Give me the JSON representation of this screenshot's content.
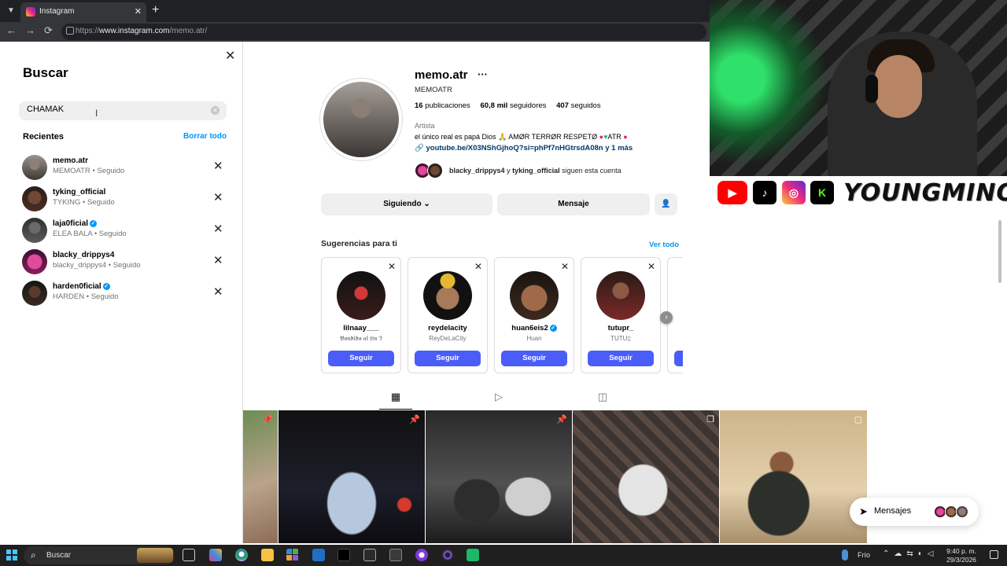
{
  "browser": {
    "tab_title": "Instagram",
    "tab_close": "✕",
    "new_tab": "+",
    "url_prefix": "https://",
    "url_host": "www.instagram.com",
    "url_path": "/memo.atr/"
  },
  "overlay": {
    "social_icons": [
      "youtube-icon",
      "tiktok-icon",
      "instagram-icon",
      "kick-icon"
    ],
    "channel_name": "YOUNGMINOR"
  },
  "search_panel": {
    "title": "Buscar",
    "query": "CHAMAK",
    "clear_glyph": "✕",
    "recents_title": "Recientes",
    "clear_all": "Borrar todo",
    "items": [
      {
        "name": "memo.atr",
        "sub": "MEMOATR • Seguido",
        "verified": false
      },
      {
        "name": "tyking_official",
        "sub": "TYKING • Seguido",
        "verified": false
      },
      {
        "name": "laja0ficial",
        "sub": "ELEA BALA • Seguido",
        "verified": true
      },
      {
        "name": "blacky_drippys4",
        "sub": "blacky_drippys4 • Seguido",
        "verified": false
      },
      {
        "name": "harden0ficial",
        "sub": "HARDEN • Seguido",
        "verified": true
      }
    ]
  },
  "profile": {
    "username": "memo.atr",
    "more": "···",
    "display_name": "MEMOATR",
    "posts_count": "16",
    "posts_label": "publicaciones",
    "followers_count": "60,8 mil",
    "followers_label": "seguidores",
    "following_count": "407",
    "following_label": "seguidos",
    "category": "Artista",
    "bio_text": "el único real es papá Dios 🙏 AMØR TERRØR RESPETØ",
    "bio_end": "ATR",
    "link": "youtube.be/X03NShGjhoQ?si=phPf7nHGtrsdA08n y 1 más",
    "followed_by_1": "blacky_drippys4",
    "followed_by_join": " y ",
    "followed_by_2": "tyking_official",
    "followed_by_suffix": " siguen esta cuenta",
    "following_button": "Siguiendo",
    "message_button": "Mensaje"
  },
  "suggestions": {
    "title": "Sugerencias para ti",
    "see_all": "Ver todo",
    "follow_label": "Seguir",
    "cards": [
      {
        "name": "lilnaay___",
        "sub": "𝕭𝖔𝖓𝖉𝖎𝖉𝖔 𝖆𝖑 𝖋𝖎𝖓 ✞",
        "verified": false
      },
      {
        "name": "reydelacity",
        "sub": "ReyDeLaCity",
        "verified": false
      },
      {
        "name": "huan6eis2",
        "sub": "Huan",
        "verified": true
      },
      {
        "name": "tutupr_",
        "sub": "TUTU▯",
        "verified": false
      }
    ]
  },
  "messages": {
    "label": "Mensajes"
  },
  "taskbar": {
    "search_label": "Buscar",
    "weather": "Frío",
    "time": "9:40 p. m.",
    "date": "29/3/2026"
  },
  "colors": {
    "accent": "#0095f6",
    "follow_button": "#4a5df9",
    "verified": "#0095f6"
  }
}
